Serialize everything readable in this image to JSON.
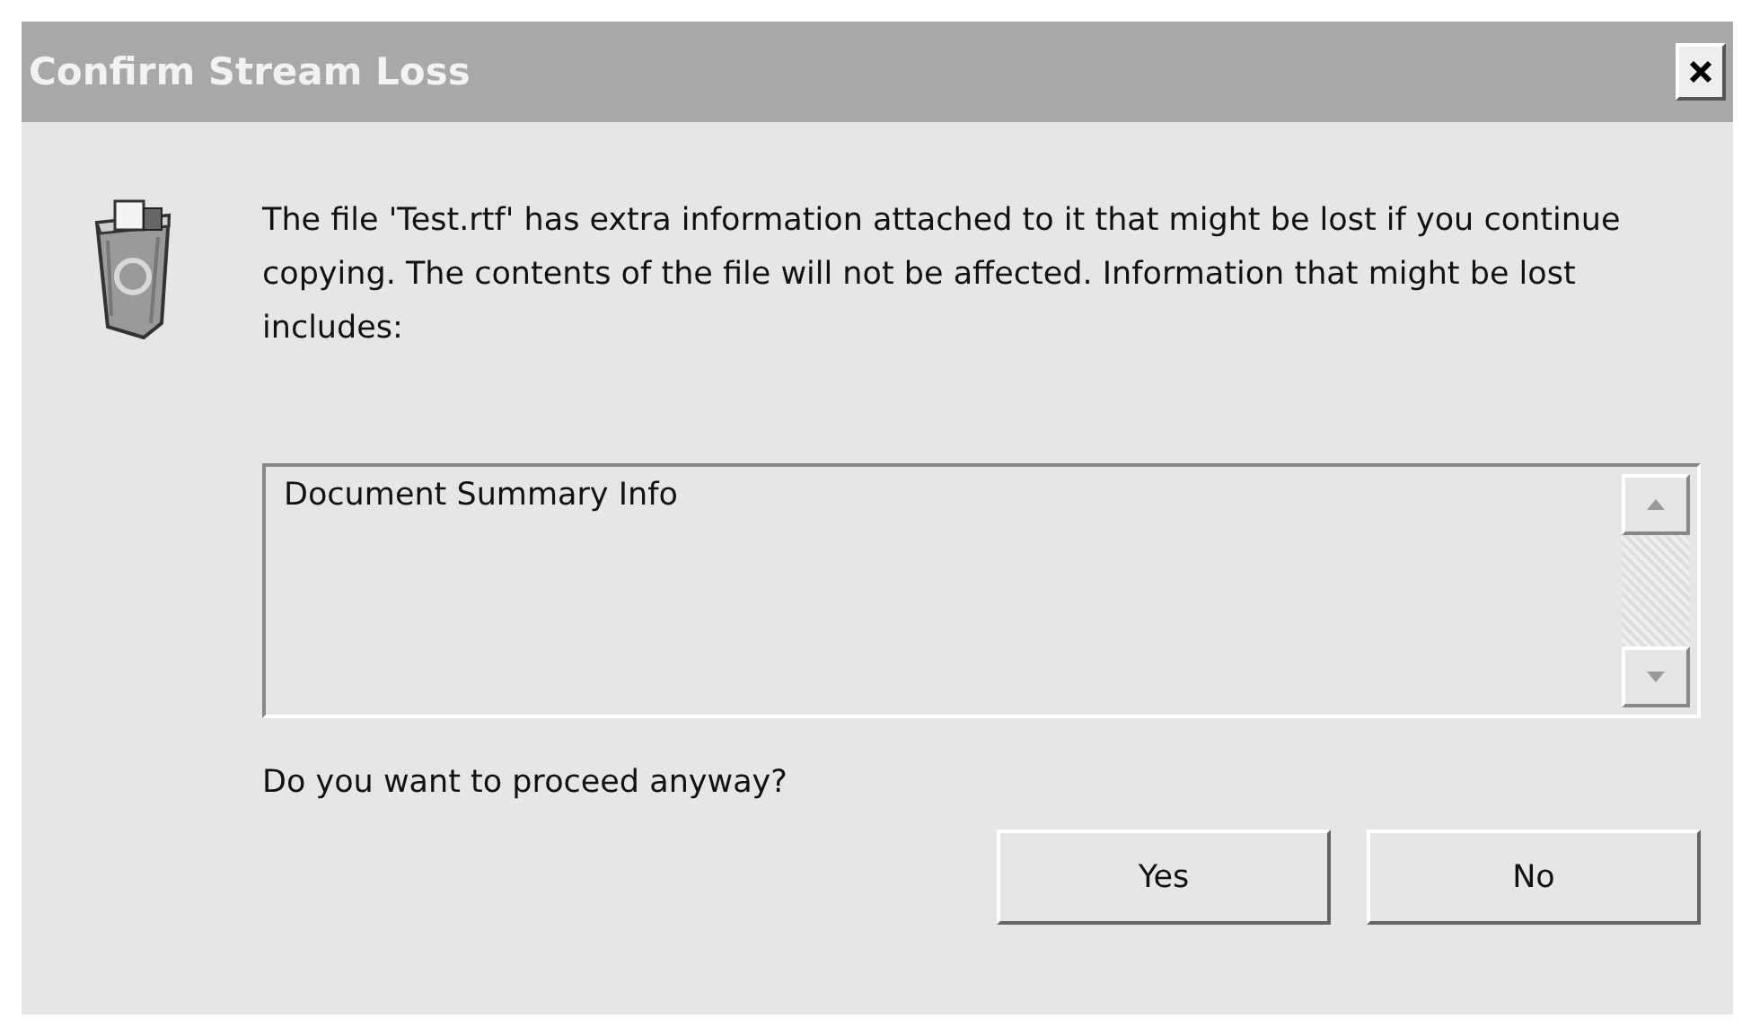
{
  "window": {
    "title": "Confirm Stream Loss"
  },
  "message": "The file 'Test.rtf' has extra information attached to it that might be lost if you continue copying. The contents of the file will not be affected. Information that might be lost includes:",
  "list": {
    "items": [
      "Document Summary Info"
    ]
  },
  "question": "Do you want to proceed anyway?",
  "buttons": [
    "Yes",
    "No"
  ]
}
